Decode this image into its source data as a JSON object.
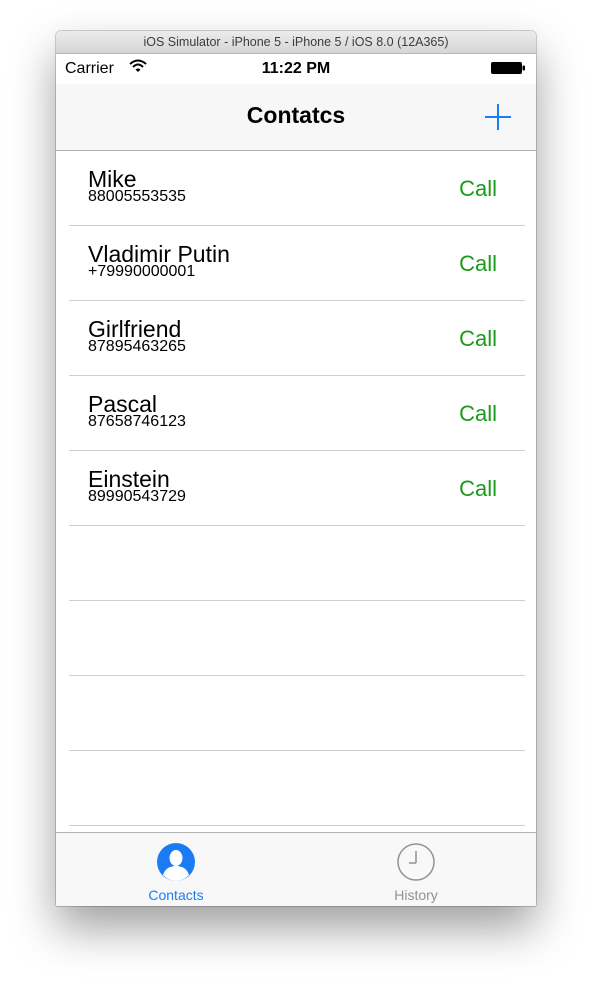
{
  "window": {
    "title": "iOS Simulator - iPhone 5 - iPhone 5 / iOS 8.0 (12A365)"
  },
  "status_bar": {
    "carrier": "Carrier",
    "wifi_icon": "wifi-icon",
    "time": "11:22 PM",
    "battery_icon": "battery-icon"
  },
  "nav_bar": {
    "title": "Contatcs",
    "add_icon": "plus-icon"
  },
  "contacts": [
    {
      "name": "Mike",
      "phone": "88005553535",
      "action": "Call"
    },
    {
      "name": "Vladimir Putin",
      "phone": "+79990000001",
      "action": "Call"
    },
    {
      "name": "Girlfriend",
      "phone": "87895463265",
      "action": "Call"
    },
    {
      "name": "Pascal",
      "phone": "87658746123",
      "action": "Call"
    },
    {
      "name": "Einstein",
      "phone": "89990543729",
      "action": "Call"
    }
  ],
  "tab_bar": {
    "tabs": [
      {
        "label": "Contacts",
        "icon": "person-icon",
        "selected": true
      },
      {
        "label": "History",
        "icon": "clock-icon",
        "selected": false
      }
    ]
  },
  "colors": {
    "accent": "#1a7cf5",
    "call": "#1a9a1a",
    "inactive": "#929292"
  }
}
